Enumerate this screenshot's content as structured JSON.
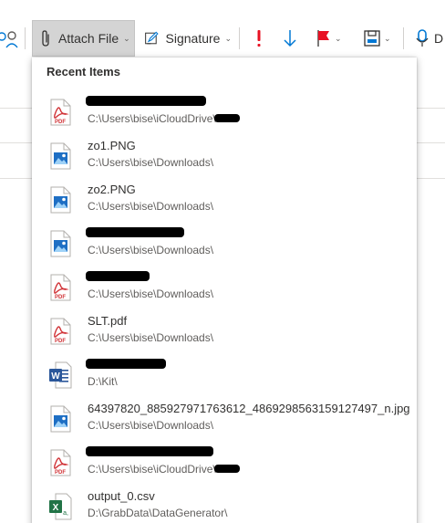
{
  "ribbon": {
    "attach_label": "Attach File",
    "signature_label": "Signature",
    "icons": [
      "people-icon",
      "paperclip-icon",
      "signature-pen-icon",
      "importance-high-icon",
      "importance-low-icon",
      "flag-icon",
      "save-template-icon",
      "microphone-icon"
    ],
    "dictate_partial": "D"
  },
  "dropdown": {
    "title": "Recent Items",
    "items": [
      {
        "type": "pdf",
        "name": "",
        "path": "C:\\Users\\bise\\iCloudDrive\\",
        "redacted": true
      },
      {
        "type": "image",
        "name": "zo1.PNG",
        "path": "C:\\Users\\bise\\Downloads\\",
        "redacted": false
      },
      {
        "type": "image",
        "name": "zo2.PNG",
        "path": "C:\\Users\\bise\\Downloads\\",
        "redacted": false
      },
      {
        "type": "image",
        "name": "",
        "path": "C:\\Users\\bise\\Downloads\\",
        "redacted": true
      },
      {
        "type": "pdf",
        "name": "",
        "path": "C:\\Users\\bise\\Downloads\\",
        "redacted": true
      },
      {
        "type": "pdf",
        "name": "SLT.pdf",
        "path": "C:\\Users\\bise\\Downloads\\",
        "redacted": false
      },
      {
        "type": "word",
        "name": "",
        "path": "D:\\Kit\\",
        "redacted": true
      },
      {
        "type": "image",
        "name": "64397820_885927971763612_4869298563159127497_n.jpg",
        "path": "C:\\Users\\bise\\Downloads\\",
        "redacted": false
      },
      {
        "type": "pdf",
        "name": "",
        "path": "C:\\Users\\bise\\iCloudDrive\\",
        "redacted": true
      },
      {
        "type": "excel",
        "name": "output_0.csv",
        "path": "D:\\GrabData\\DataGenerator\\",
        "redacted": false
      }
    ]
  },
  "colors": {
    "pdf_red": "#d13438",
    "image_blue": "#1e6fc4",
    "word_blue": "#2b579a",
    "excel_green": "#217346",
    "importance_red": "#e81123",
    "accent_blue": "#0078d4"
  }
}
